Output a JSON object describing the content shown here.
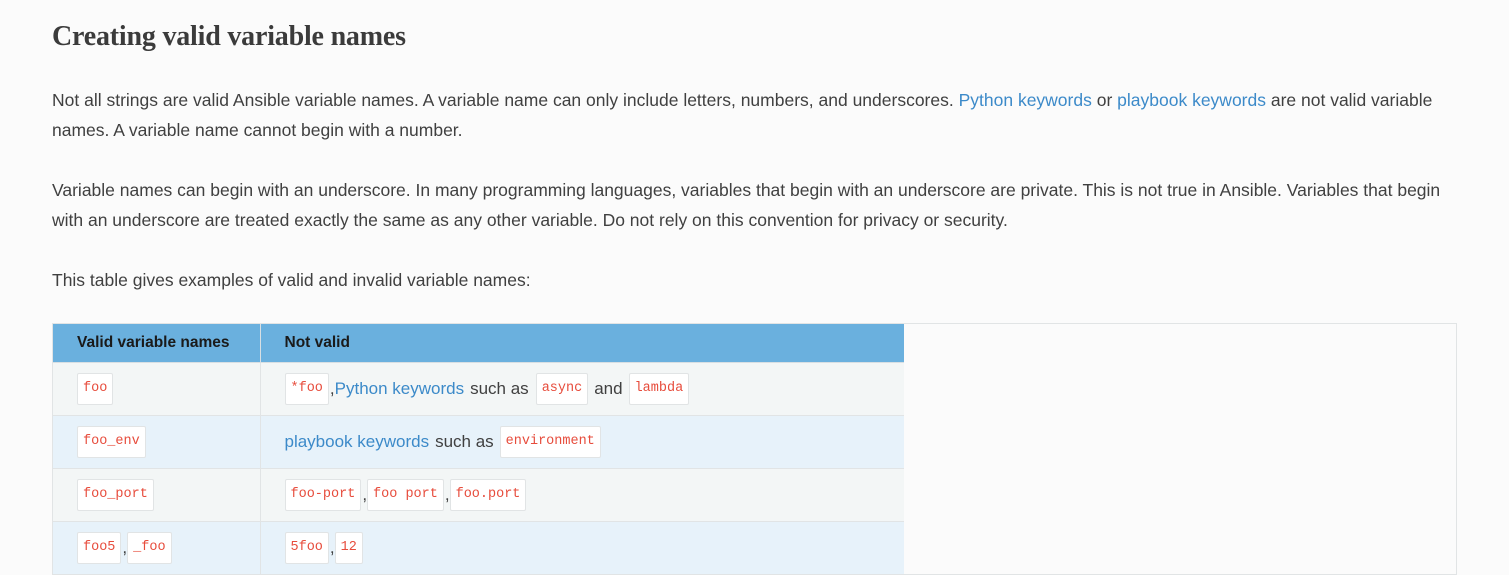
{
  "page": {
    "title": "Creating valid variable names",
    "paragraphs": {
      "p1": {
        "seg1": "Not all strings are valid Ansible variable names. A variable name can only include letters, numbers, and underscores. ",
        "link1": "Python keywords",
        "seg2": " or ",
        "link2": "playbook keywords",
        "seg3": " are not valid variable names. A variable name cannot begin with a number."
      },
      "p2": "Variable names can begin with an underscore. In many programming languages, variables that begin with an underscore are private. This is not true in Ansible. Variables that begin with an underscore are treated exactly the same as any other variable. Do not rely on this convention for privacy or security.",
      "p3": "This table gives examples of valid and invalid variable names:"
    }
  },
  "table": {
    "headers": [
      "Valid variable names",
      "Not valid"
    ],
    "rows": [
      {
        "valid": {
          "codes": [
            "foo"
          ]
        },
        "invalid": {
          "code1": "*foo",
          "comma1": ",",
          "link": "Python keywords",
          "text1": "such as",
          "code2": "async",
          "text2": "and",
          "code3": "lambda"
        }
      },
      {
        "valid": {
          "codes": [
            "foo_env"
          ]
        },
        "invalid": {
          "link": "playbook keywords",
          "text1": "such as",
          "code1": "environment"
        }
      },
      {
        "valid": {
          "codes": [
            "foo_port"
          ]
        },
        "invalid": {
          "code1": "foo-port",
          "comma1": ",",
          "code2": "foo port",
          "comma2": ",",
          "code3": "foo.port"
        }
      },
      {
        "valid": {
          "codes": [
            "foo5",
            "_foo"
          ],
          "comma": ","
        },
        "invalid": {
          "code1": "5foo",
          "comma1": ",",
          "code2": "12"
        }
      }
    ]
  },
  "colors": {
    "header_bg": "#6ab0de",
    "link": "#3c8ac9",
    "code_text": "#e74c3c",
    "row_odd": "#f3f6f6",
    "row_even": "#e7f2fa",
    "border": "#e1e4e5",
    "page_bg": "#fbfbfb"
  }
}
